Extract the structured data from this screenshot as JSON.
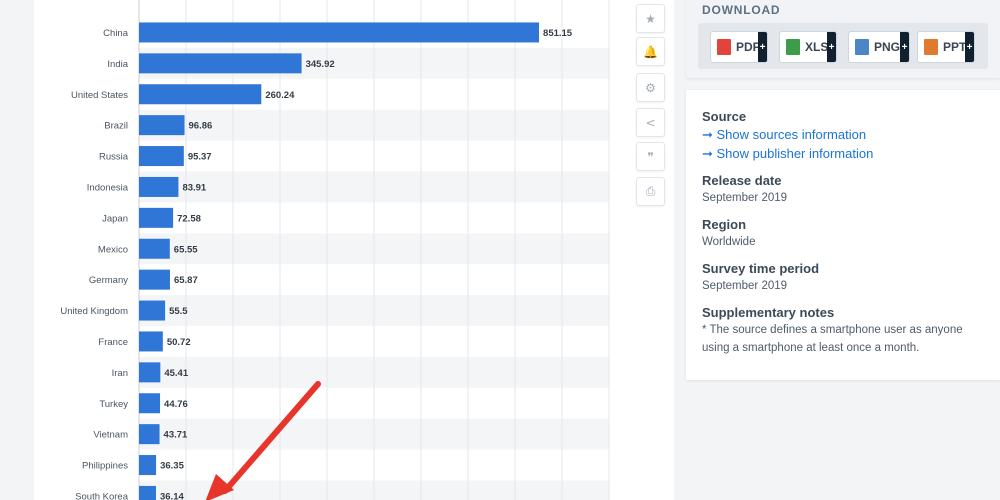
{
  "chart_data": {
    "type": "bar",
    "orientation": "horizontal",
    "categories": [
      "China",
      "India",
      "United States",
      "Brazil",
      "Russia",
      "Indonesia",
      "Japan",
      "Mexico",
      "Germany",
      "United Kingdom",
      "France",
      "Iran",
      "Turkey",
      "Vietnam",
      "Philippines",
      "South Korea"
    ],
    "values": [
      851.15,
      345.92,
      260.24,
      96.86,
      95.37,
      83.91,
      72.58,
      65.55,
      65.87,
      55.5,
      50.72,
      45.41,
      44.76,
      43.71,
      36.35,
      36.14
    ],
    "value_labels": [
      "851.15",
      "345.92",
      "260.24",
      "96.86",
      "95.37",
      "83.91",
      "72.58",
      "65.55",
      "65.87",
      "55.5",
      "50.72",
      "45.41",
      "44.76",
      "43.71",
      "36.35",
      "36.14"
    ],
    "xlim": [
      0,
      1000
    ],
    "grid": true,
    "bar_color": "#2f76d6"
  },
  "toolbar": {
    "icons": [
      "star-icon",
      "bell-icon",
      "gear-icon",
      "share-icon",
      "quote-icon",
      "print-icon"
    ],
    "glyphs": [
      "★",
      "🔔",
      "⚙",
      "<",
      "❞",
      "⎙"
    ]
  },
  "download": {
    "title": "DOWNLOAD",
    "buttons": [
      {
        "label": "PDF",
        "color": "#e0443a"
      },
      {
        "label": "XLS",
        "color": "#3c9c4a"
      },
      {
        "label": "PNG",
        "color": "#4d86c6"
      },
      {
        "label": "PPT",
        "color": "#e07a2f"
      }
    ],
    "plus": "+"
  },
  "info": {
    "source_heading": "Source",
    "link1": "➞ Show sources information",
    "link2": "➞ Show publisher information",
    "release_heading": "Release date",
    "release_value": "September 2019",
    "region_heading": "Region",
    "region_value": "Worldwide",
    "survey_heading": "Survey time period",
    "survey_value": "September 2019",
    "notes_heading": "Supplementary notes",
    "notes_value": "* The source defines a smartphone user as anyone using a smartphone at least once a month."
  },
  "annotation": {
    "color": "#e8352c"
  }
}
